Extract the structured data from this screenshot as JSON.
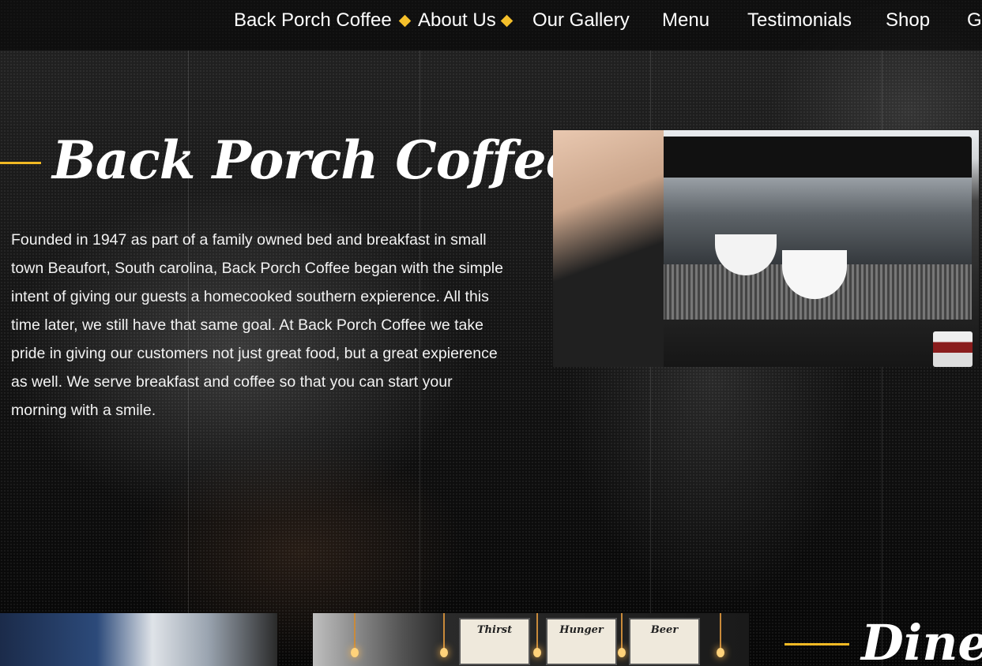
{
  "nav": {
    "items": [
      {
        "label": "Back Porch Coffee"
      },
      {
        "label": "About Us"
      },
      {
        "label": "Our Gallery"
      },
      {
        "label": "Menu"
      },
      {
        "label": "Testimonials"
      },
      {
        "label": "Shop"
      },
      {
        "label": "Go"
      }
    ],
    "separator_icon": "diamond-icon",
    "accent_color": "#f5c02b"
  },
  "about": {
    "title": "Back Porch Coffee",
    "description": "Founded in 1947 as part of a family owned bed and breakfast in small town Beaufort, South carolina, Back Porch Coffee began with the simple intent of giving our guests a homecooked southern expierence. All this time later, we still have that same goal. At Back Porch Coffee we take pride in giving our customers not just great food, but a great expierence as well. We serve breakfast and coffee so that you can start your morning with a smile."
  },
  "menu_boards": {
    "board1": "Thirst",
    "board2": "Hunger",
    "board3": "Beer"
  },
  "dine": {
    "title": "Dine i"
  },
  "colors": {
    "accent": "#f1b924",
    "background": "#0b0b0b",
    "text": "#ffffff"
  }
}
